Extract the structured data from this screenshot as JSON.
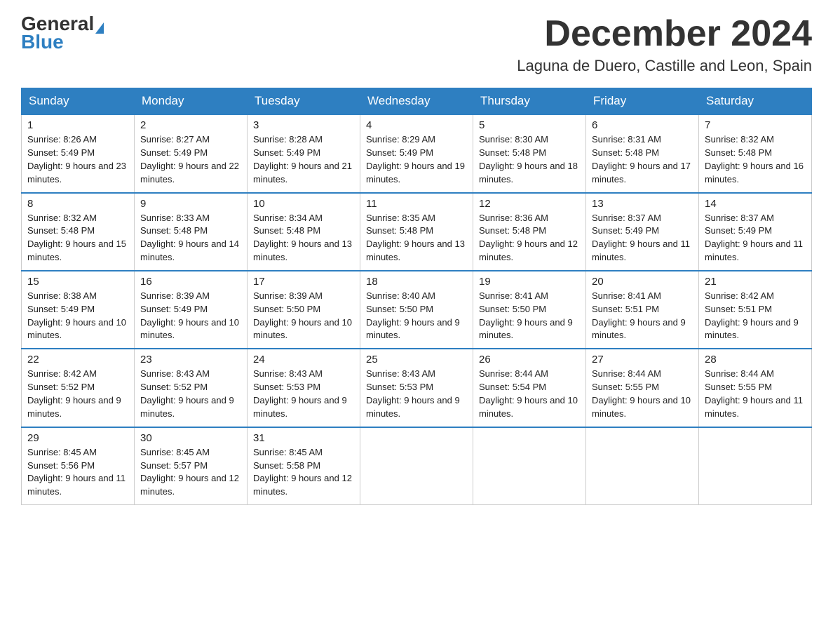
{
  "header": {
    "logo_general": "General",
    "logo_blue": "Blue",
    "month_title": "December 2024",
    "location": "Laguna de Duero, Castille and Leon, Spain"
  },
  "days_of_week": [
    "Sunday",
    "Monday",
    "Tuesday",
    "Wednesday",
    "Thursday",
    "Friday",
    "Saturday"
  ],
  "weeks": [
    [
      {
        "day": 1,
        "sunrise": "8:26 AM",
        "sunset": "5:49 PM",
        "daylight": "9 hours and 23 minutes."
      },
      {
        "day": 2,
        "sunrise": "8:27 AM",
        "sunset": "5:49 PM",
        "daylight": "9 hours and 22 minutes."
      },
      {
        "day": 3,
        "sunrise": "8:28 AM",
        "sunset": "5:49 PM",
        "daylight": "9 hours and 21 minutes."
      },
      {
        "day": 4,
        "sunrise": "8:29 AM",
        "sunset": "5:49 PM",
        "daylight": "9 hours and 19 minutes."
      },
      {
        "day": 5,
        "sunrise": "8:30 AM",
        "sunset": "5:48 PM",
        "daylight": "9 hours and 18 minutes."
      },
      {
        "day": 6,
        "sunrise": "8:31 AM",
        "sunset": "5:48 PM",
        "daylight": "9 hours and 17 minutes."
      },
      {
        "day": 7,
        "sunrise": "8:32 AM",
        "sunset": "5:48 PM",
        "daylight": "9 hours and 16 minutes."
      }
    ],
    [
      {
        "day": 8,
        "sunrise": "8:32 AM",
        "sunset": "5:48 PM",
        "daylight": "9 hours and 15 minutes."
      },
      {
        "day": 9,
        "sunrise": "8:33 AM",
        "sunset": "5:48 PM",
        "daylight": "9 hours and 14 minutes."
      },
      {
        "day": 10,
        "sunrise": "8:34 AM",
        "sunset": "5:48 PM",
        "daylight": "9 hours and 13 minutes."
      },
      {
        "day": 11,
        "sunrise": "8:35 AM",
        "sunset": "5:48 PM",
        "daylight": "9 hours and 13 minutes."
      },
      {
        "day": 12,
        "sunrise": "8:36 AM",
        "sunset": "5:48 PM",
        "daylight": "9 hours and 12 minutes."
      },
      {
        "day": 13,
        "sunrise": "8:37 AM",
        "sunset": "5:49 PM",
        "daylight": "9 hours and 11 minutes."
      },
      {
        "day": 14,
        "sunrise": "8:37 AM",
        "sunset": "5:49 PM",
        "daylight": "9 hours and 11 minutes."
      }
    ],
    [
      {
        "day": 15,
        "sunrise": "8:38 AM",
        "sunset": "5:49 PM",
        "daylight": "9 hours and 10 minutes."
      },
      {
        "day": 16,
        "sunrise": "8:39 AM",
        "sunset": "5:49 PM",
        "daylight": "9 hours and 10 minutes."
      },
      {
        "day": 17,
        "sunrise": "8:39 AM",
        "sunset": "5:50 PM",
        "daylight": "9 hours and 10 minutes."
      },
      {
        "day": 18,
        "sunrise": "8:40 AM",
        "sunset": "5:50 PM",
        "daylight": "9 hours and 9 minutes."
      },
      {
        "day": 19,
        "sunrise": "8:41 AM",
        "sunset": "5:50 PM",
        "daylight": "9 hours and 9 minutes."
      },
      {
        "day": 20,
        "sunrise": "8:41 AM",
        "sunset": "5:51 PM",
        "daylight": "9 hours and 9 minutes."
      },
      {
        "day": 21,
        "sunrise": "8:42 AM",
        "sunset": "5:51 PM",
        "daylight": "9 hours and 9 minutes."
      }
    ],
    [
      {
        "day": 22,
        "sunrise": "8:42 AM",
        "sunset": "5:52 PM",
        "daylight": "9 hours and 9 minutes."
      },
      {
        "day": 23,
        "sunrise": "8:43 AM",
        "sunset": "5:52 PM",
        "daylight": "9 hours and 9 minutes."
      },
      {
        "day": 24,
        "sunrise": "8:43 AM",
        "sunset": "5:53 PM",
        "daylight": "9 hours and 9 minutes."
      },
      {
        "day": 25,
        "sunrise": "8:43 AM",
        "sunset": "5:53 PM",
        "daylight": "9 hours and 9 minutes."
      },
      {
        "day": 26,
        "sunrise": "8:44 AM",
        "sunset": "5:54 PM",
        "daylight": "9 hours and 10 minutes."
      },
      {
        "day": 27,
        "sunrise": "8:44 AM",
        "sunset": "5:55 PM",
        "daylight": "9 hours and 10 minutes."
      },
      {
        "day": 28,
        "sunrise": "8:44 AM",
        "sunset": "5:55 PM",
        "daylight": "9 hours and 11 minutes."
      }
    ],
    [
      {
        "day": 29,
        "sunrise": "8:45 AM",
        "sunset": "5:56 PM",
        "daylight": "9 hours and 11 minutes."
      },
      {
        "day": 30,
        "sunrise": "8:45 AM",
        "sunset": "5:57 PM",
        "daylight": "9 hours and 12 minutes."
      },
      {
        "day": 31,
        "sunrise": "8:45 AM",
        "sunset": "5:58 PM",
        "daylight": "9 hours and 12 minutes."
      },
      null,
      null,
      null,
      null
    ]
  ]
}
